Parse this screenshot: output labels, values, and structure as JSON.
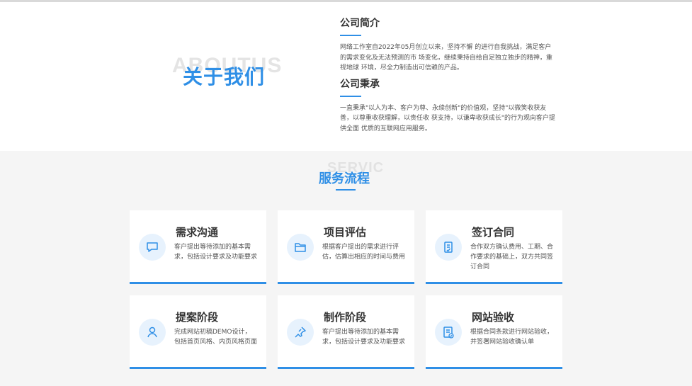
{
  "about": {
    "watermark": "ABOUTUS",
    "title": "关于我们",
    "intro_title": "公司简介",
    "intro_text": "网络工作室自2022年05月创立以来，坚持不懈 的进行自我挑战，满足客户的需求变化及无法预测的市 场变化，继续秉持自给自足独立独步的精神，重视地球 环境，尽全力制造出可信赖的产品。",
    "mission_title": "公司秉承",
    "mission_text": "一直秉承\"以人为本、客户为尊、永续创新\"的价值观，坚持\"以微笑收获友善，以尊重收获理解，以责任收 获支持，以谦卑收获成长\"的行为观向客户提供全面 优质的互联网应用服务。"
  },
  "service": {
    "watermark": "SERVIC",
    "title": "服务流程",
    "cards": [
      {
        "title": "需求沟通",
        "desc": "客户提出等待添加的基本需求，包括设计要求及功能要求",
        "icon": "chat-icon"
      },
      {
        "title": "项目评估",
        "desc": "根据客户提出的需求进行评估，估算出相应的时间与费用",
        "icon": "folder-icon"
      },
      {
        "title": "签订合同",
        "desc": "合作双方确认费用、工期、合作要求的基础上，双方共同签订合同",
        "icon": "contract-icon"
      },
      {
        "title": "提案阶段",
        "desc": "完成网站初稿DEMO设计，包括首页风格、内页风格页面",
        "icon": "user-icon"
      },
      {
        "title": "制作阶段",
        "desc": "客户提出等待添加的基本需求，包括设计要求及功能要求",
        "icon": "pin-icon"
      },
      {
        "title": "网站验收",
        "desc": "根据合同条款进行网站验收，并签署网站验收确认单",
        "icon": "checklist-icon"
      }
    ]
  },
  "colors": {
    "accent": "#2f8fe6",
    "icon_bg": "#e7f2fd",
    "section_bg": "#f5f5f5"
  }
}
